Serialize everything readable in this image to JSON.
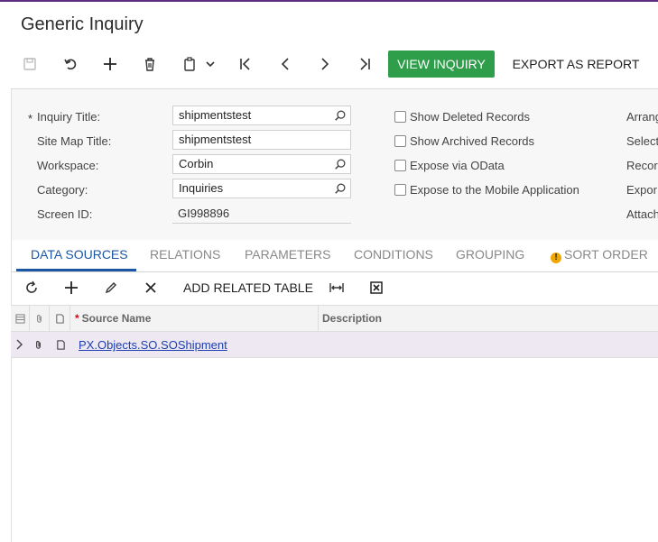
{
  "page": {
    "title": "Generic Inquiry"
  },
  "toolbar": {
    "icons": [
      "save-icon",
      "undo-icon",
      "add-icon",
      "delete-icon",
      "copy-paste-icon",
      "first-record-icon",
      "previous-record-icon",
      "next-record-icon",
      "last-record-icon"
    ],
    "view_inquiry": "VIEW INQUIRY",
    "export_report": "EXPORT AS REPORT",
    "accent": "#2e9e4a"
  },
  "form": {
    "required_mark": "*",
    "inquiry_title": {
      "label": "Inquiry Title:",
      "value": "shipmentstest"
    },
    "site_map_title": {
      "label": "Site Map Title:",
      "value": "shipmentstest"
    },
    "workspace": {
      "label": "Workspace:",
      "value": "Corbin"
    },
    "category": {
      "label": "Category:",
      "value": "Inquiries"
    },
    "screen_id": {
      "label": "Screen ID:",
      "value": "GI998896"
    },
    "checkboxes": {
      "show_deleted": {
        "label": "Show Deleted Records",
        "checked": false
      },
      "show_archived": {
        "label": "Show Archived Records",
        "checked": false
      },
      "expose_odata": {
        "label": "Expose via OData",
        "checked": false
      },
      "expose_mobile": {
        "label": "Expose to the Mobile Application",
        "checked": false
      }
    },
    "right_column": [
      "Arrang",
      "Select",
      "Recor",
      "Expor",
      "Attach"
    ]
  },
  "tabs": [
    {
      "label": "DATA SOURCES",
      "active": true
    },
    {
      "label": "RELATIONS",
      "active": false
    },
    {
      "label": "PARAMETERS",
      "active": false
    },
    {
      "label": "CONDITIONS",
      "active": false
    },
    {
      "label": "GROUPING",
      "active": false
    },
    {
      "label": "SORT ORDER",
      "active": false,
      "warning": true
    }
  ],
  "grid_toolbar": {
    "icons": [
      "refresh-icon",
      "add-row-icon",
      "edit-icon",
      "delete-row-icon",
      "fit-columns-icon",
      "export-excel-icon"
    ],
    "add_related_table": "ADD RELATED TABLE"
  },
  "grid": {
    "columns": {
      "source_name": "Source Name",
      "description": "Description",
      "required_mark": "*"
    },
    "rows": [
      {
        "source_name": "PX.Objects.SO.SOShipment",
        "description": ""
      }
    ]
  },
  "colors": {
    "link": "#1c3fb0",
    "tab_active": "#1c57a5",
    "selected_row": "#ede8f2"
  }
}
